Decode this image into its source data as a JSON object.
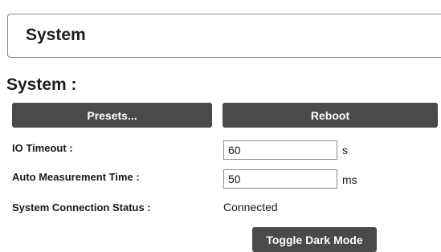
{
  "header": {
    "title": "System"
  },
  "section": {
    "heading": "System :"
  },
  "buttons": {
    "presets": "Presets...",
    "reboot": "Reboot",
    "toggle_dark_mode": "Toggle Dark Mode"
  },
  "settings": {
    "io_timeout": {
      "label": "IO Timeout :",
      "value": "60",
      "unit": "s"
    },
    "auto_measurement_time": {
      "label": "Auto Measurement Time :",
      "value": "50",
      "unit": "ms"
    },
    "connection_status": {
      "label": "System Connection Status :",
      "value": "Connected"
    }
  },
  "colors": {
    "button_bg": "#4a4a4a",
    "button_text": "#ffffff",
    "border": "#8a8a8a"
  }
}
